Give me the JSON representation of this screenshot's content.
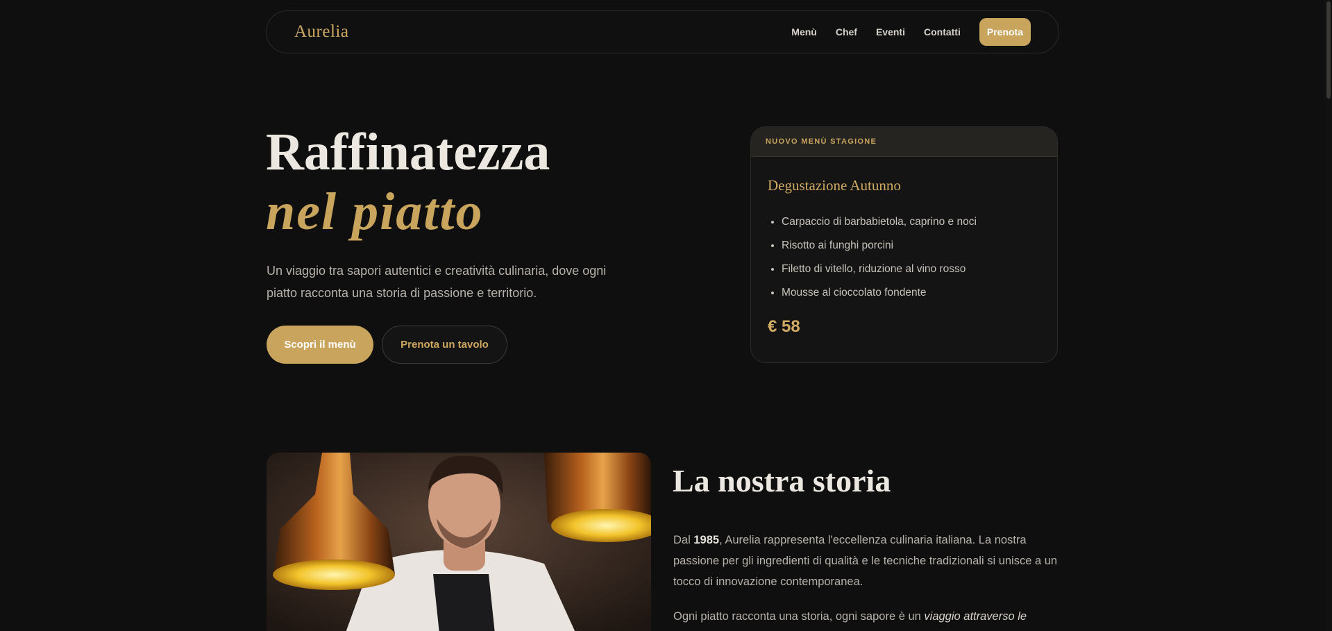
{
  "nav": {
    "brand": "Aurelia",
    "links": [
      "Menù",
      "Chef",
      "Eventi",
      "Contatti"
    ],
    "cta": "Prenota"
  },
  "hero": {
    "title_line1": "Raffinatezza",
    "title_line2": "nel piatto",
    "subtitle": "Un viaggio tra sapori autentici e creatività culinaria, dove ogni piatto racconta una storia di passione e territorio.",
    "primary_button": "Scopri il menù",
    "secondary_button": "Prenota un tavolo"
  },
  "card": {
    "badge": "NUOVO MENÙ STAGIONE",
    "title": "Degustazione Autunno",
    "items": [
      "Carpaccio di barbabietola, caprino e noci",
      "Risotto ai funghi porcini",
      "Filetto di vitello, riduzione al vino rosso",
      "Mousse al cioccolato fondente"
    ],
    "price": "€ 58"
  },
  "story": {
    "title": "La nostra storia",
    "p1_prefix": "Dal ",
    "p1_year": "1985",
    "p1_rest": ", Aurelia rappresenta l'eccellenza culinaria italiana. La nostra passione per gli ingredienti di qualità e le tecniche tradizionali si unisce a un tocco di innovazione contemporanea.",
    "p2_prefix": "Ogni piatto racconta una storia, ogni sapore è un ",
    "p2_italic": "viaggio attraverso le"
  },
  "colors": {
    "background": "#0f0f10",
    "accent_gold": "#c9a45c",
    "text_light": "#ece8e1",
    "text_muted": "#b7b2aa"
  }
}
